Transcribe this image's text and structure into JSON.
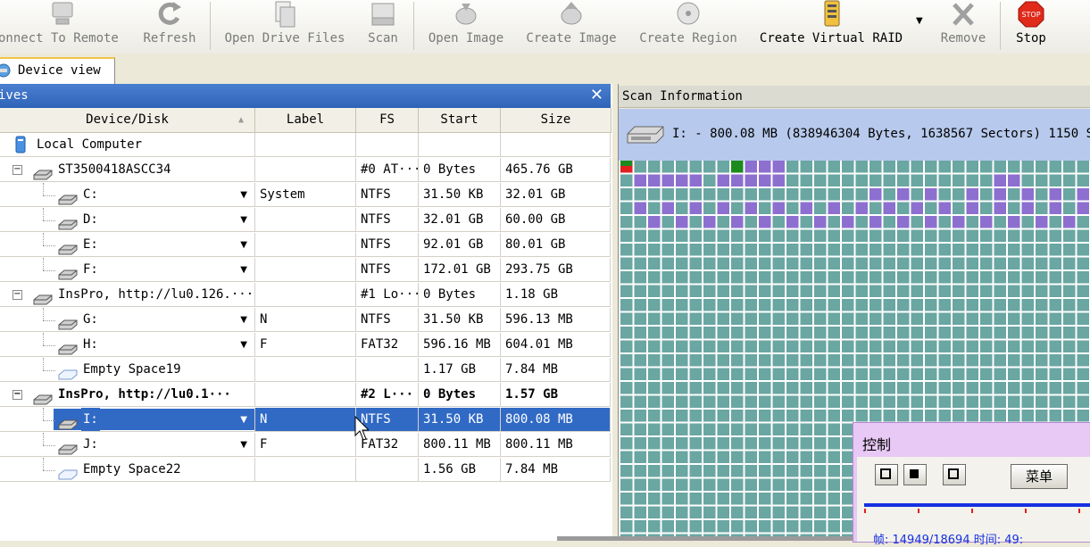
{
  "toolbar": {
    "items": [
      {
        "label": "onnect To Remote",
        "icon": "remote-computer-icon"
      },
      {
        "label": "Refresh",
        "icon": "refresh-icon"
      },
      {
        "label": "Open Drive Files",
        "icon": "open-drive-files-icon"
      },
      {
        "label": "Scan",
        "icon": "scan-icon"
      },
      {
        "label": "Open Image",
        "icon": "open-image-icon"
      },
      {
        "label": "Create Image",
        "icon": "create-image-icon"
      },
      {
        "label": "Create Region",
        "icon": "create-region-icon"
      },
      {
        "label": "Create Virtual RAID",
        "icon": "virtual-raid-icon"
      },
      {
        "label": "Remove",
        "icon": "remove-icon"
      },
      {
        "label": "Stop",
        "icon": "stop-icon"
      }
    ],
    "stop_icon_text": "STOP"
  },
  "tabs": [
    {
      "label": "Device view"
    }
  ],
  "drives_panel": {
    "title": "ives",
    "close": "✕",
    "columns": [
      "Device/Disk",
      "Label",
      "FS",
      "Start",
      "Size"
    ],
    "rows": [
      {
        "name": "Local Computer",
        "label": "",
        "fs": "",
        "start": "",
        "size": ""
      },
      {
        "name": "ST3500418ASCC34",
        "label": "",
        "fs": "#0 AT···",
        "start": "0 Bytes",
        "size": "465.76 GB"
      },
      {
        "name": "C:",
        "label": "System",
        "fs": "NTFS",
        "start": "31.50 KB",
        "size": "32.01 GB"
      },
      {
        "name": "D:",
        "label": "",
        "fs": "NTFS",
        "start": "32.01 GB",
        "size": "60.00 GB"
      },
      {
        "name": "E:",
        "label": "",
        "fs": "NTFS",
        "start": "92.01 GB",
        "size": "80.01 GB"
      },
      {
        "name": "F:",
        "label": "",
        "fs": "NTFS",
        "start": "172.01 GB",
        "size": "293.75 GB"
      },
      {
        "name": "InsPro, http://lu0.126.···",
        "label": "",
        "fs": "#1 Lo···",
        "start": "0 Bytes",
        "size": "1.18 GB"
      },
      {
        "name": "G:",
        "label": "N",
        "fs": "NTFS",
        "start": "31.50 KB",
        "size": "596.13 MB"
      },
      {
        "name": "H:",
        "label": "F",
        "fs": "FAT32",
        "start": "596.16 MB",
        "size": "604.01 MB"
      },
      {
        "name": "Empty Space19",
        "label": "",
        "fs": "",
        "start": "1.17 GB",
        "size": "7.84 MB"
      },
      {
        "name": "InsPro, http://lu0.1···",
        "label": "",
        "fs": "#2 L···",
        "start": "0 Bytes",
        "size": "1.57 GB"
      },
      {
        "name": "I:",
        "label": "N",
        "fs": "NTFS",
        "start": "31.50 KB",
        "size": "800.08 MB"
      },
      {
        "name": "J:",
        "label": "F",
        "fs": "FAT32",
        "start": "800.11 MB",
        "size": "800.11 MB"
      },
      {
        "name": "Empty Space22",
        "label": "",
        "fs": "",
        "start": "1.56 GB",
        "size": "7.84 MB"
      }
    ],
    "selected_row": 11
  },
  "scan_panel": {
    "title": "Scan Information",
    "info": "I: - 800.08 MB (838946304 Bytes, 1638567 Sectors) 1150 S",
    "colors": {
      "cell": "#6aa6a2",
      "used": "#8d6fd0",
      "read": "#1c8a1c",
      "error": "#e02020"
    }
  },
  "control_window": {
    "title": "控制",
    "menu_label": "菜单",
    "frame_text": "帧: 14949/18694 时间: 49:"
  }
}
